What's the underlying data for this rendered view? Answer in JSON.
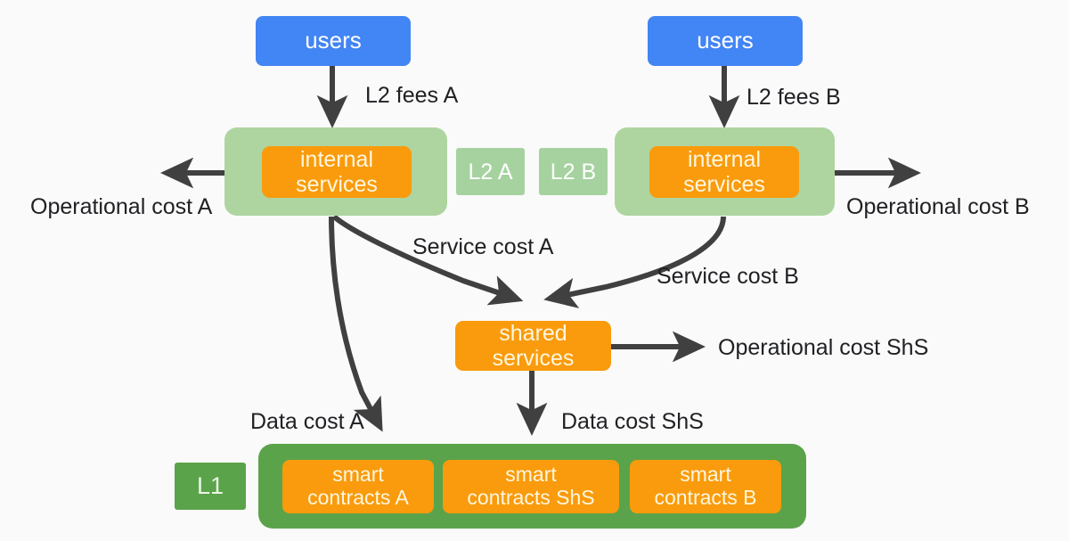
{
  "diagram": {
    "title": "L2 shared services cost flow diagram",
    "background_color": "#FAFAFA",
    "colors": {
      "users": "#4285F4",
      "l2_container": "#AED5A0",
      "service_box": "#F99B0C",
      "l1_container": "#5BA34A",
      "arrow": "#404040",
      "label_text": "#202124"
    }
  },
  "nodes": {
    "users_a": {
      "label": "users"
    },
    "users_b": {
      "label": "users"
    },
    "l2_a_tag": {
      "label": "L2 A"
    },
    "l2_b_tag": {
      "label": "L2 B"
    },
    "internal_services_a": {
      "label": "internal\nservices"
    },
    "internal_services_b": {
      "label": "internal\nservices"
    },
    "shared_services": {
      "label": "shared\nservices"
    },
    "l1_tag": {
      "label": "L1"
    },
    "smart_contracts_a": {
      "label": "smart\ncontracts A"
    },
    "smart_contracts_shs": {
      "label": "smart\ncontracts ShS"
    },
    "smart_contracts_b": {
      "label": "smart\ncontracts B"
    }
  },
  "edge_labels": {
    "l2_fees_a": "L2 fees A",
    "l2_fees_b": "L2 fees B",
    "operational_cost_a": "Operational cost A",
    "operational_cost_b": "Operational cost B",
    "service_cost_a": "Service cost A",
    "service_cost_b": "Service cost B",
    "operational_cost_shs": "Operational cost ShS",
    "data_cost_a": "Data cost A",
    "data_cost_shs": "Data cost ShS"
  }
}
